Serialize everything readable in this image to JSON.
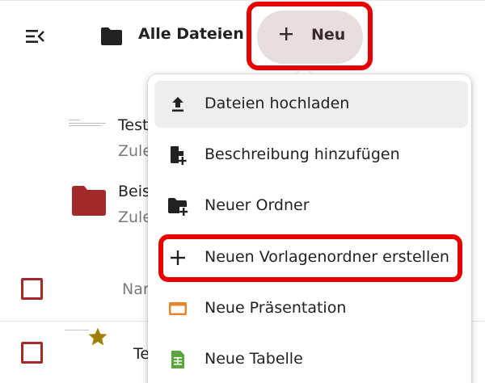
{
  "header": {
    "title": "Alle Dateien",
    "new_button_label": "Neu",
    "toggle_icon": "menu-collapse-icon",
    "folder_icon": "folder-icon"
  },
  "files": {
    "row1": {
      "name": "Test",
      "sub": "Zule"
    },
    "row2": {
      "name": "Beis",
      "sub": "Zule"
    },
    "column_name": "Nar",
    "row3": {
      "name": "Te"
    }
  },
  "new_menu": {
    "items": [
      {
        "label": "Dateien hochladen",
        "icon": "upload-icon"
      },
      {
        "label": "Beschreibung hinzufügen",
        "icon": "file-plus-icon"
      },
      {
        "label": "Neuer Ordner",
        "icon": "folder-plus-icon"
      },
      {
        "label": "Neuen Vorlagenordner erstellen",
        "icon": "plus-icon"
      },
      {
        "label": "Neue Präsentation",
        "icon": "presentation-icon"
      },
      {
        "label": "Neue Tabelle",
        "icon": "spreadsheet-icon"
      }
    ]
  },
  "colors": {
    "accent_red": "#e60000",
    "folder_red": "#a32a2a",
    "new_button_bg": "#e9dede",
    "star_gold": "#a08000",
    "presentation_orange": "#e8842c",
    "spreadsheet_green": "#5aa63c"
  }
}
